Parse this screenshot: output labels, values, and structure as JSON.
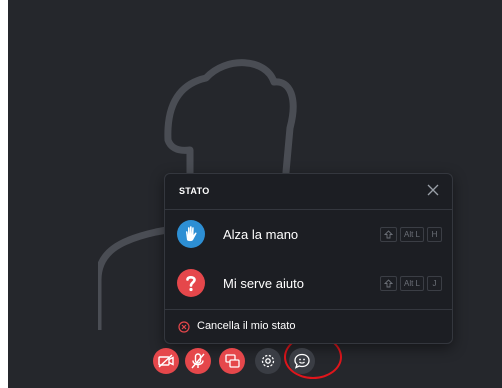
{
  "status_panel": {
    "title": "STATO",
    "items": [
      {
        "label": "Alza la mano",
        "keys": [
          "Alt L",
          "H"
        ],
        "icon": "raised-hand-icon",
        "color": "#2d8fd4"
      },
      {
        "label": "Mi serve aiuto",
        "keys": [
          "Alt L",
          "J"
        ],
        "icon": "question-icon",
        "color": "#e5474b"
      }
    ],
    "clear_label": "Cancella il mio stato"
  },
  "toolbar": {
    "buttons": [
      "camera-off-icon",
      "microphone-off-icon",
      "screen-share-icon",
      "settings-icon",
      "chat-status-icon"
    ]
  }
}
